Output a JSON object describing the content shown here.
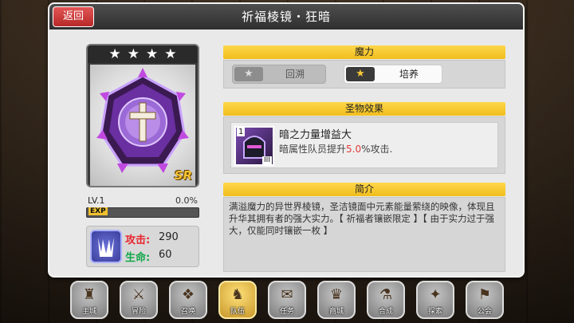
{
  "header": {
    "title": "祈福棱镜・狂暗",
    "back_label": "返回"
  },
  "card": {
    "stars": "★★★★",
    "rarity": "SR"
  },
  "level": {
    "label": "LV.1",
    "percent_text": "0.0%",
    "progress": 0.0,
    "exp_label": "EXP"
  },
  "stats": {
    "attack": {
      "label": "攻击:",
      "value": "290"
    },
    "hp": {
      "label": "生命:",
      "value": "60"
    }
  },
  "magic": {
    "heading": "魔力",
    "retro_label": "回溯",
    "train_label": "培养"
  },
  "effect": {
    "heading": "圣物效果",
    "number": "1",
    "roman": "III",
    "title": "暗之力量增益大",
    "desc_prefix": "暗属性队员提升",
    "desc_value": "5.0",
    "desc_suffix": "%攻击."
  },
  "intro": {
    "heading": "简介",
    "text": "满溢魔力的异世界棱镜，圣洁镜面中元素能量萦绕的映像，体现且升华其拥有者的强大实力。【 祈福者镶嵌限定 】【 由于实力过于强大，仅能同时镶嵌一枚 】"
  },
  "nav": [
    {
      "label": "主城",
      "icon": "castle-icon",
      "glyph": "♜",
      "active": false
    },
    {
      "label": "冒险",
      "icon": "swords-icon",
      "glyph": "⚔",
      "active": false
    },
    {
      "label": "召唤",
      "icon": "cards-icon",
      "glyph": "❖",
      "active": false
    },
    {
      "label": "队伍",
      "icon": "helmet-icon",
      "glyph": "♞",
      "active": true
    },
    {
      "label": "任务",
      "icon": "scroll-icon",
      "glyph": "✉",
      "active": false
    },
    {
      "label": "商城",
      "icon": "shop-icon",
      "glyph": "♛",
      "active": false
    },
    {
      "label": "合成",
      "icon": "cauldron-icon",
      "glyph": "⚗",
      "active": false
    },
    {
      "label": "探索",
      "icon": "compass-icon",
      "glyph": "✦",
      "active": false
    },
    {
      "label": "公会",
      "icon": "guild-icon",
      "glyph": "⚑",
      "active": false
    }
  ]
}
